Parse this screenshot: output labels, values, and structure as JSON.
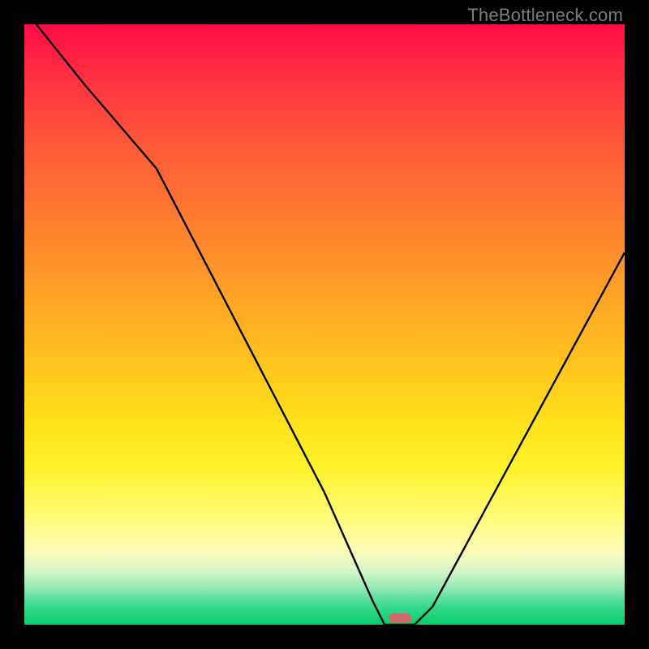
{
  "watermark": "TheBottleneck.com",
  "chart_data": {
    "type": "line",
    "title": "",
    "xlabel": "",
    "ylabel": "",
    "xlim": [
      0,
      100
    ],
    "ylim": [
      0,
      100
    ],
    "series": [
      {
        "name": "curve",
        "x": [
          2,
          10,
          22,
          50,
          58,
          60,
          65,
          68,
          100
        ],
        "values": [
          100,
          90,
          76,
          22,
          4,
          0,
          0,
          3,
          62
        ]
      }
    ],
    "background_gradient": {
      "direction": "vertical",
      "stops": [
        {
          "pct": 0,
          "color": "#ff0b47"
        },
        {
          "pct": 20,
          "color": "#ff5838"
        },
        {
          "pct": 44,
          "color": "#ffa026"
        },
        {
          "pct": 66,
          "color": "#ffe11a"
        },
        {
          "pct": 88,
          "color": "#f9fbb8"
        },
        {
          "pct": 97,
          "color": "#37d98e"
        },
        {
          "pct": 100,
          "color": "#06ce6b"
        }
      ]
    },
    "marker": {
      "x": 62.5,
      "color": "#d06a6a"
    }
  }
}
